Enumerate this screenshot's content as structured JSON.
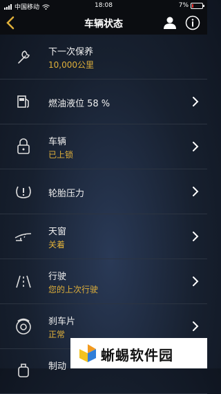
{
  "status_bar": {
    "carrier": "中国移动",
    "time": "18:08",
    "battery": "7%"
  },
  "header": {
    "title": "车辆状态",
    "icons": [
      "chevron-left-icon",
      "user-icon",
      "info-icon"
    ]
  },
  "rows": [
    {
      "title": "下一次保养",
      "sub": "10,000公里",
      "icon": "wrench-icon",
      "chevron": false
    },
    {
      "title": "燃油液位 58 %",
      "sub": "",
      "icon": "fuel-pump-icon",
      "chevron": true
    },
    {
      "title": "车辆",
      "sub": "已上锁",
      "icon": "lock-icon",
      "chevron": true
    },
    {
      "title": "轮胎压力",
      "sub": "",
      "icon": "tire-pressure-icon",
      "chevron": true
    },
    {
      "title": "天窗",
      "sub": "关着",
      "icon": "sunroof-icon",
      "chevron": true
    },
    {
      "title": "行驶",
      "sub": "您的上次行驶",
      "icon": "road-icon",
      "chevron": true
    },
    {
      "title": "刹车片",
      "sub": "正常",
      "icon": "brake-disc-icon",
      "chevron": true
    },
    {
      "title": "制动",
      "sub": "",
      "icon": "brake-fluid-icon",
      "chevron": false
    }
  ],
  "watermark": {
    "text": "蜥蜴软件园"
  },
  "colors": {
    "accent": "#e0b03a",
    "background": "#17202f",
    "bar": "#0b0d11"
  }
}
